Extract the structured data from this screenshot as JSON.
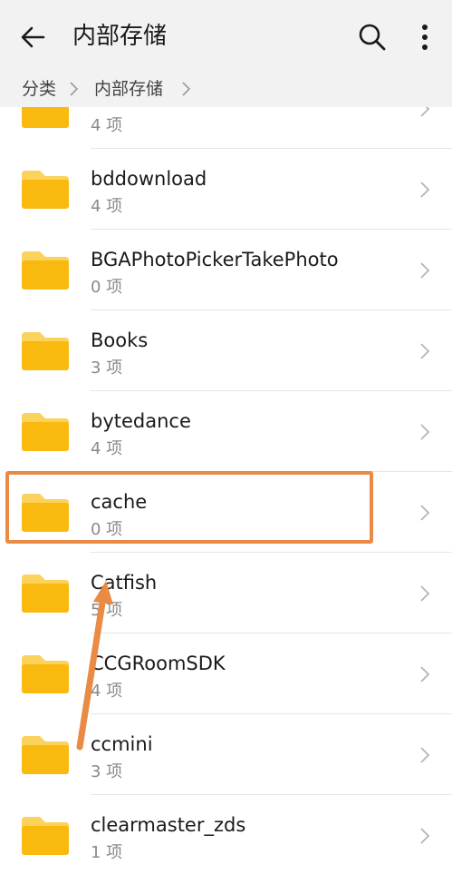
{
  "header": {
    "title": "内部存储",
    "back_icon": "arrow-left-icon",
    "search_icon": "search-icon",
    "more_icon": "more-vertical-icon"
  },
  "breadcrumb": {
    "items": [
      "分类",
      "内部存储"
    ]
  },
  "folders": [
    {
      "name": "",
      "count": "4 项"
    },
    {
      "name": "bddownload",
      "count": "4 项"
    },
    {
      "name": "BGAPhotoPickerTakePhoto",
      "count": "0 项"
    },
    {
      "name": "Books",
      "count": "3 项"
    },
    {
      "name": "bytedance",
      "count": "4 项"
    },
    {
      "name": "cache",
      "count": "0 项"
    },
    {
      "name": "Catfish",
      "count": "5 项"
    },
    {
      "name": "CCGRoomSDK",
      "count": "4 项"
    },
    {
      "name": "ccmini",
      "count": "3 项"
    },
    {
      "name": "clearmaster_zds",
      "count": "1 项"
    }
  ],
  "colors": {
    "folder": "#f9b90f",
    "folder_tab": "#fbd25b",
    "annotation": "#e98a45"
  }
}
